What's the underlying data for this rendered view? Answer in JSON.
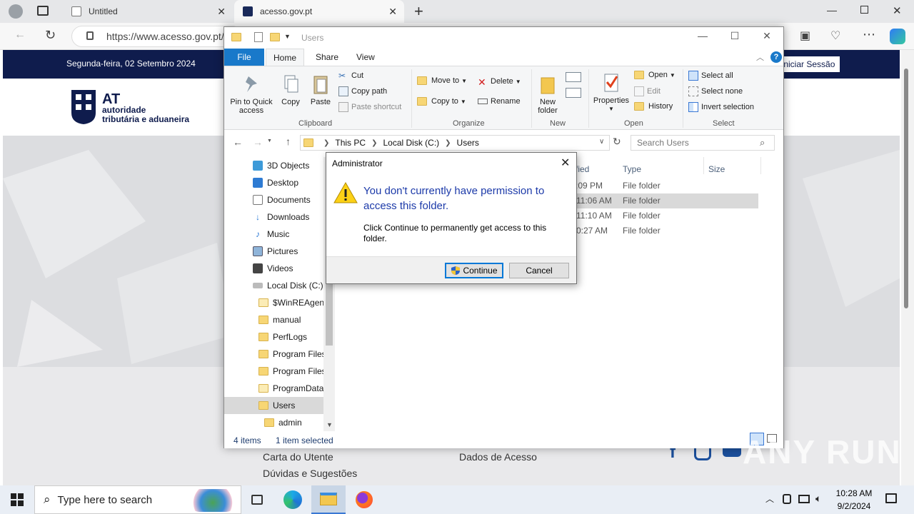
{
  "browser": {
    "tabs": [
      {
        "title": "Untitled"
      },
      {
        "title": "acesso.gov.pt"
      }
    ],
    "new_tab_symbol": "+",
    "url": "https://www.acesso.gov.pt/"
  },
  "website": {
    "date": "Segunda-feira, 02 Setembro 2024",
    "login_button": "Iniciar Sessão",
    "logo": {
      "at": "AT",
      "line1": "autoridade",
      "line2": "tributária e aduaneira"
    },
    "footer_links": [
      "Carta do Utente",
      "Dúvidas e Sugestões",
      "Dados de Acesso"
    ]
  },
  "explorer": {
    "title": "Users",
    "ribbon_tabs": [
      "File",
      "Home",
      "Share",
      "View"
    ],
    "ribbon": {
      "clipboard": {
        "label": "Clipboard",
        "pin": "Pin to Quick access",
        "copy": "Copy",
        "paste": "Paste",
        "cut": "Cut",
        "copy_path": "Copy path",
        "paste_shortcut": "Paste shortcut"
      },
      "organize": {
        "label": "Organize",
        "move_to": "Move to",
        "copy_to": "Copy to",
        "delete": "Delete",
        "rename": "Rename"
      },
      "new": {
        "label": "New",
        "new_folder": "New folder"
      },
      "open": {
        "label": "Open",
        "properties": "Properties",
        "open": "Open",
        "edit": "Edit",
        "history": "History"
      },
      "select": {
        "label": "Select",
        "select_all": "Select all",
        "select_none": "Select none",
        "invert": "Invert selection"
      }
    },
    "path": [
      "This PC",
      "Local Disk (C:)",
      "Users"
    ],
    "search_placeholder": "Search Users",
    "nav_items": [
      "3D Objects",
      "Desktop",
      "Documents",
      "Downloads",
      "Music",
      "Pictures",
      "Videos",
      "Local Disk (C:)",
      "$WinREAgent",
      "manual",
      "PerfLogs",
      "Program Files",
      "Program Files",
      "ProgramData",
      "Users",
      "admin"
    ],
    "columns": [
      "fied",
      "Type",
      "Size"
    ],
    "rows": [
      {
        "modified": ":09 PM",
        "type": "File folder"
      },
      {
        "modified": "11:06 AM",
        "type": "File folder"
      },
      {
        "modified": "11:10 AM",
        "type": "File folder"
      },
      {
        "modified": "0:27 AM",
        "type": "File folder"
      }
    ],
    "status": {
      "items": "4 items",
      "selected": "1 item selected"
    }
  },
  "dialog": {
    "title": "Administrator",
    "main_instruction": "You don't currently have permission to access this folder.",
    "content": "Click Continue to permanently get access to this folder.",
    "continue_label": "Continue",
    "cancel_label": "Cancel"
  },
  "taskbar": {
    "search_placeholder": "Type here to search",
    "time": "10:28 AM",
    "date": "9/2/2024"
  },
  "watermark": "ANY RUN",
  "colors": {
    "accent": "#1979ca",
    "site_navy": "#0f1c4d",
    "dialog_instruction": "#1c3aa9"
  }
}
